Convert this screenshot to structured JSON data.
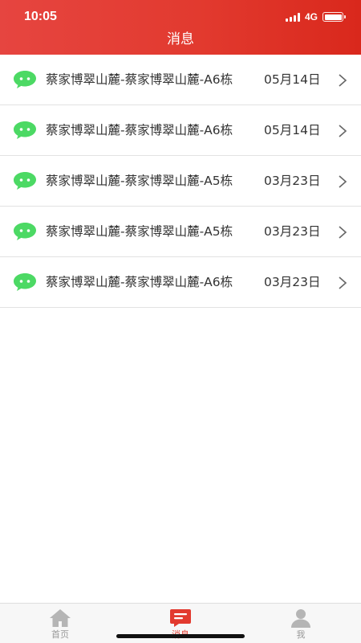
{
  "status_bar": {
    "time": "10:05",
    "network": "4G"
  },
  "header": {
    "title": "消息"
  },
  "colors": {
    "accent": "#e23a2f",
    "chat_icon": "#4cd964",
    "text": "#333333",
    "inactive": "#999999"
  },
  "messages": [
    {
      "title": "蔡家博翠山麓-蔡家博翠山麓-A6栋",
      "date": "05月14日",
      "icon": "chat-bubble-icon"
    },
    {
      "title": "蔡家博翠山麓-蔡家博翠山麓-A6栋",
      "date": "05月14日",
      "icon": "chat-bubble-icon"
    },
    {
      "title": "蔡家博翠山麓-蔡家博翠山麓-A5栋",
      "date": "03月23日",
      "icon": "chat-bubble-icon"
    },
    {
      "title": "蔡家博翠山麓-蔡家博翠山麓-A5栋",
      "date": "03月23日",
      "icon": "chat-bubble-icon"
    },
    {
      "title": "蔡家博翠山麓-蔡家博翠山麓-A6栋",
      "date": "03月23日",
      "icon": "chat-bubble-icon"
    }
  ],
  "tabbar": {
    "tabs": [
      {
        "label": "首页",
        "icon": "home-icon",
        "active": false
      },
      {
        "label": "消息",
        "icon": "message-icon",
        "active": true
      },
      {
        "label": "我",
        "icon": "user-icon",
        "active": false
      }
    ]
  }
}
